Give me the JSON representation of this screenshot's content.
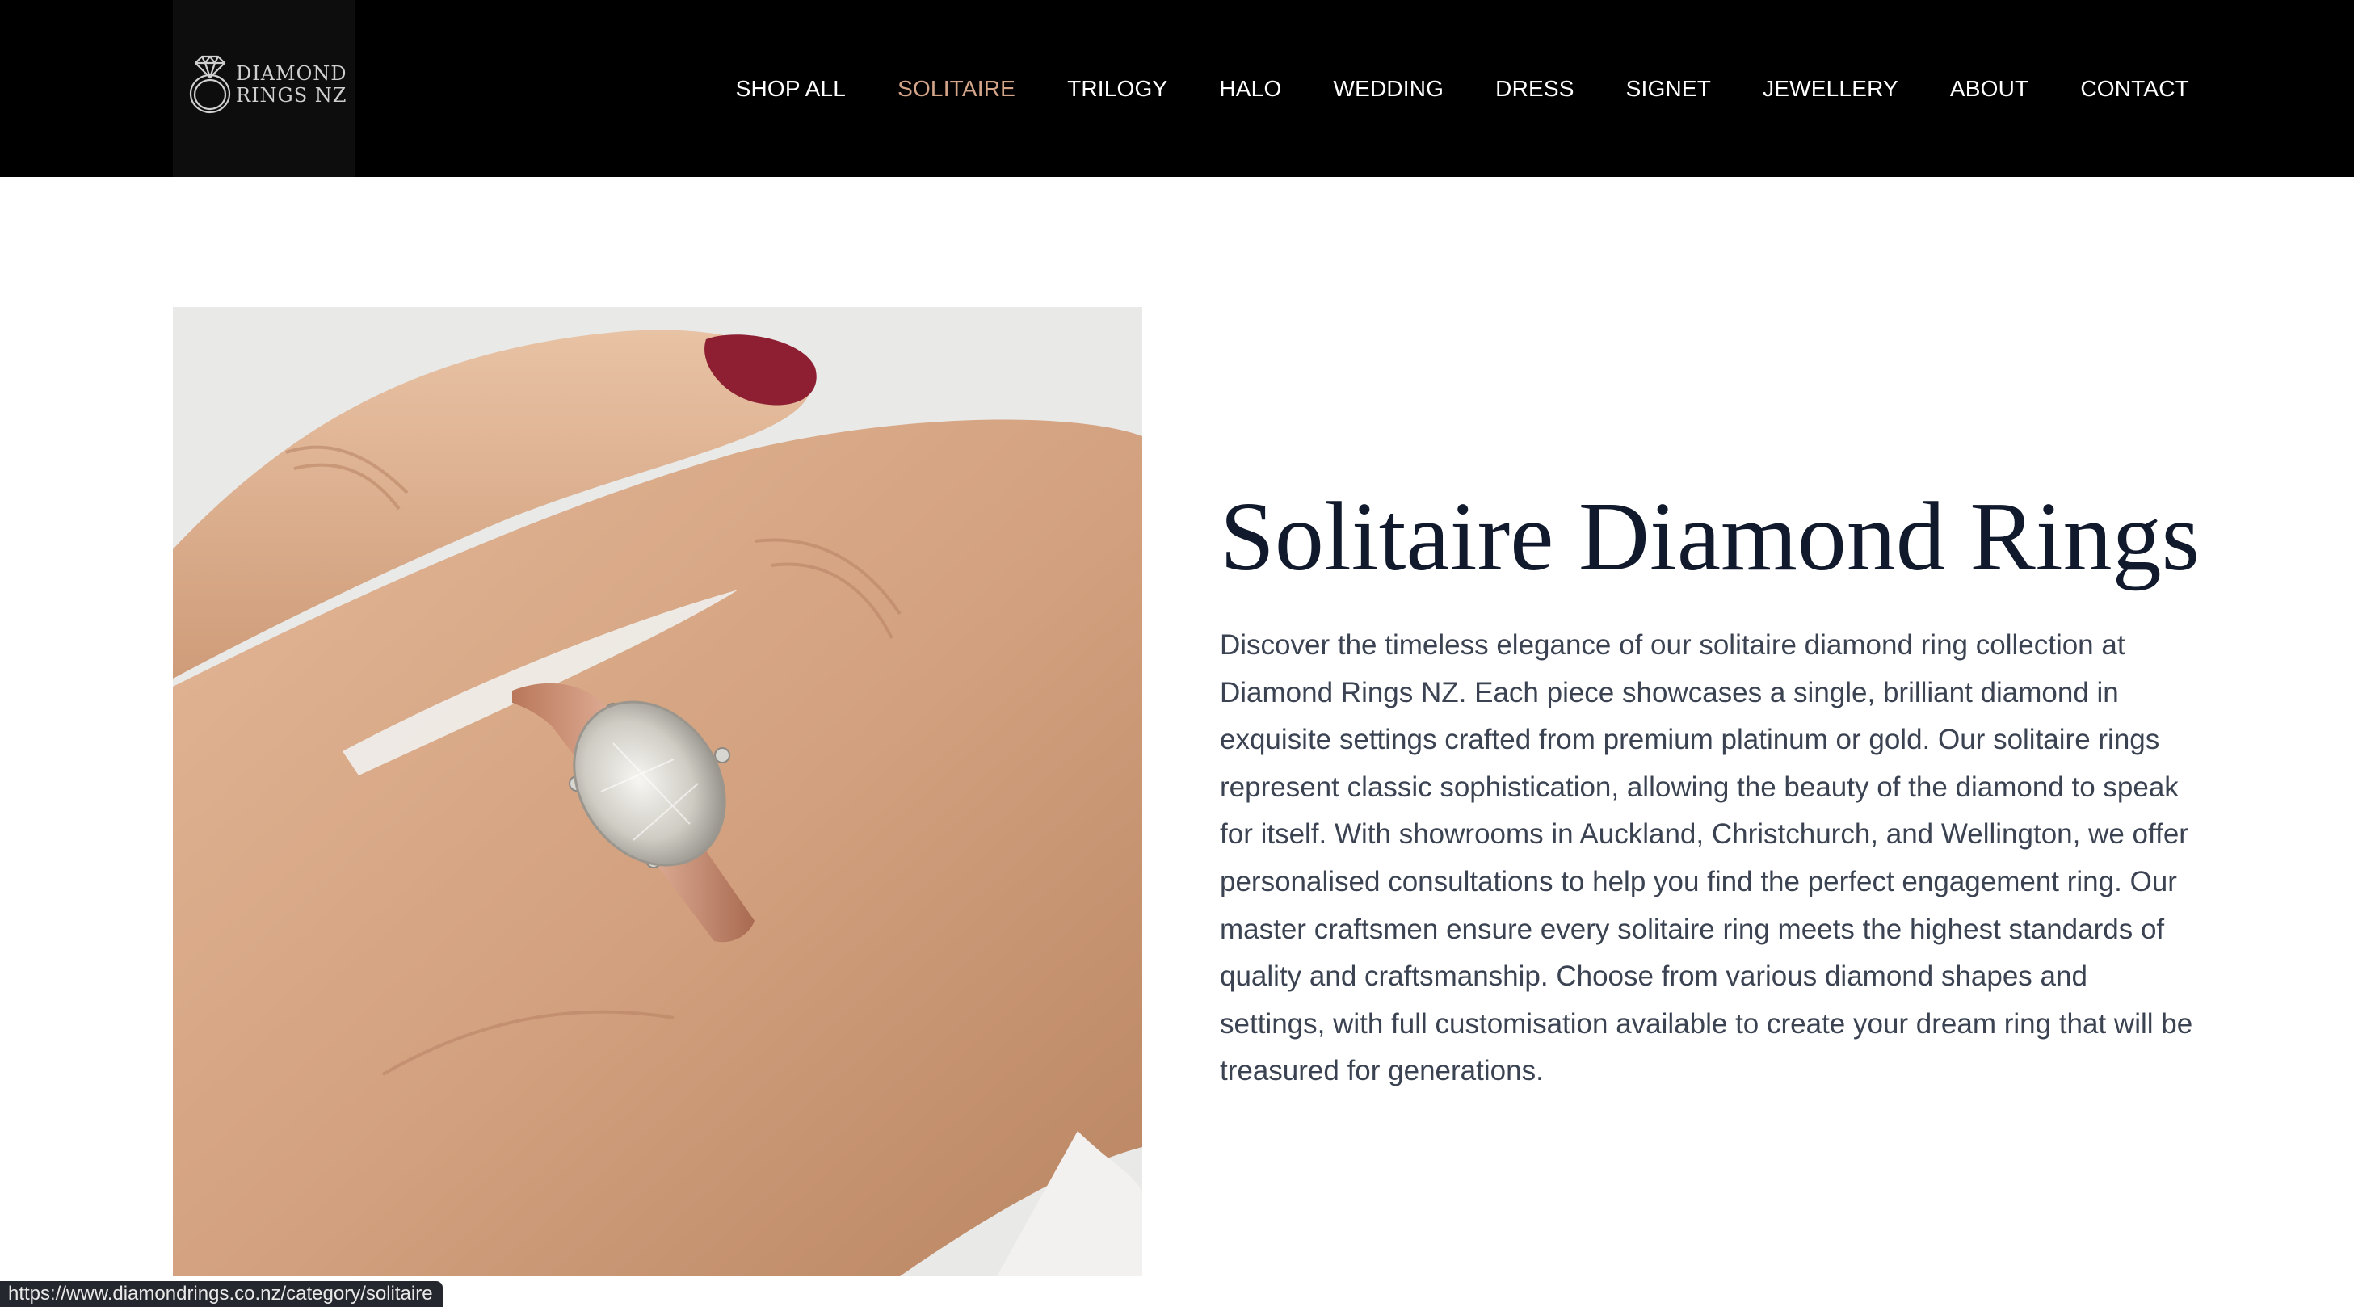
{
  "header": {
    "logo": {
      "line1": "DIAMOND",
      "line2": "RINGS NZ",
      "icon": "diamond-ring-icon"
    },
    "nav": [
      {
        "label": "SHOP ALL",
        "active": false
      },
      {
        "label": "SOLITAIRE",
        "active": true
      },
      {
        "label": "TRILOGY",
        "active": false
      },
      {
        "label": "HALO",
        "active": false
      },
      {
        "label": "WEDDING",
        "active": false
      },
      {
        "label": "DRESS",
        "active": false
      },
      {
        "label": "SIGNET",
        "active": false
      },
      {
        "label": "JEWELLERY",
        "active": false
      },
      {
        "label": "ABOUT",
        "active": false
      },
      {
        "label": "CONTACT",
        "active": false
      }
    ]
  },
  "main": {
    "title": "Solitaire Diamond Rings",
    "description": "Discover the timeless elegance of our solitaire diamond ring collection at Diamond Rings NZ. Each piece showcases a single, brilliant diamond in exquisite settings crafted from premium platinum or gold. Our solitaire rings represent classic sophistication, allowing the beauty of the diamond to speak for itself. With showrooms in Auckland, Christchurch, and Wellington, we offer personalised consultations to help you find the perfect engagement ring. Our master craftsmen ensure every solitaire ring meets the highest standards of quality and craftsmanship. Choose from various diamond shapes and settings, with full customisation available to create your dream ring that will be treasured for generations.",
    "image": {
      "subject": "hand wearing rose gold solitaire oval diamond ring"
    }
  },
  "status_bar": {
    "url": "https://www.diamondrings.co.nz/category/solitaire"
  },
  "colors": {
    "header_bg": "#000000",
    "nav_text": "#ffffff",
    "nav_active": "#d4a589",
    "title": "#111a2c",
    "body_text": "#3b4352"
  }
}
